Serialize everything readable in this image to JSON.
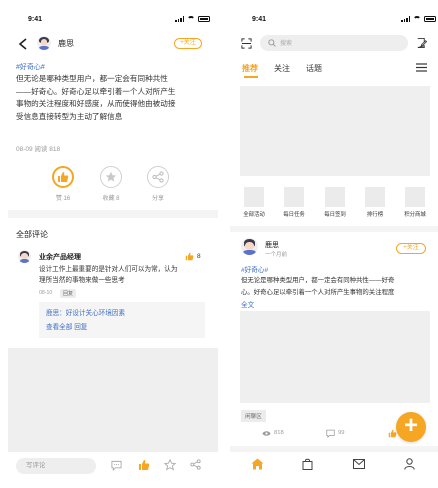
{
  "left": {
    "status_time": "9:41",
    "author": "鹿思",
    "follow_label": "+关注",
    "hashtag": "#好奇心#",
    "body_lines": [
      "但无论是哪种类型用户，都一定会有同种共性",
      "——好奇心。好奇心足以牵引着一个人对所产生",
      "事物的关注程度和好感度，从而使得他由被动接",
      "受信息直接转型为主动了解信息"
    ],
    "meta": "08-09  阅读 818",
    "actions": [
      {
        "icon": "thumbs-up-icon",
        "label": "赞 16"
      },
      {
        "icon": "star-icon",
        "label": "收藏 8"
      },
      {
        "icon": "share-icon",
        "label": "分享"
      }
    ],
    "comments_title": "全部评论",
    "comment": {
      "author": "业余产品经理",
      "likes": "8",
      "lines": [
        "设计工作上最重要的是针对人们可以为常，认为",
        "理所当然的事物来做一些思考"
      ],
      "time": "08-10",
      "badge": "回复",
      "reply": "鹿思：好设计关心环境因素",
      "view_all": "查看全部 回复"
    },
    "bottom": {
      "input_placeholder": "写评论",
      "icons": [
        "comment-icon",
        "thumbs-up-icon",
        "star-icon",
        "share-icon"
      ]
    },
    "colors": {
      "accent": "#f5a623",
      "link": "#3d6fc7"
    }
  },
  "right": {
    "status_time": "9:41",
    "search_placeholder": "搜索",
    "tabs": [
      "推荐",
      "关注",
      "话题"
    ],
    "active_tab": 0,
    "quick": [
      "全部活动",
      "每日任务",
      "每日签到",
      "排行榜",
      "积分商城"
    ],
    "feed": {
      "author": "鹿思",
      "time": "一个月前",
      "follow_label": "+关注",
      "hashtag": "#好奇心#",
      "lines": [
        "但无论是哪种类型用户，都一定会有同种共性——好奇",
        "心。好奇心足以牵引着一个人对所产生事物的关注程度"
      ],
      "full_text": "全文",
      "tag": "闲聊区",
      "views": "818",
      "comments": "99",
      "likes": "16"
    },
    "fab": "+",
    "nav": [
      "home-icon",
      "bag-icon",
      "mail-icon",
      "user-icon"
    ]
  }
}
